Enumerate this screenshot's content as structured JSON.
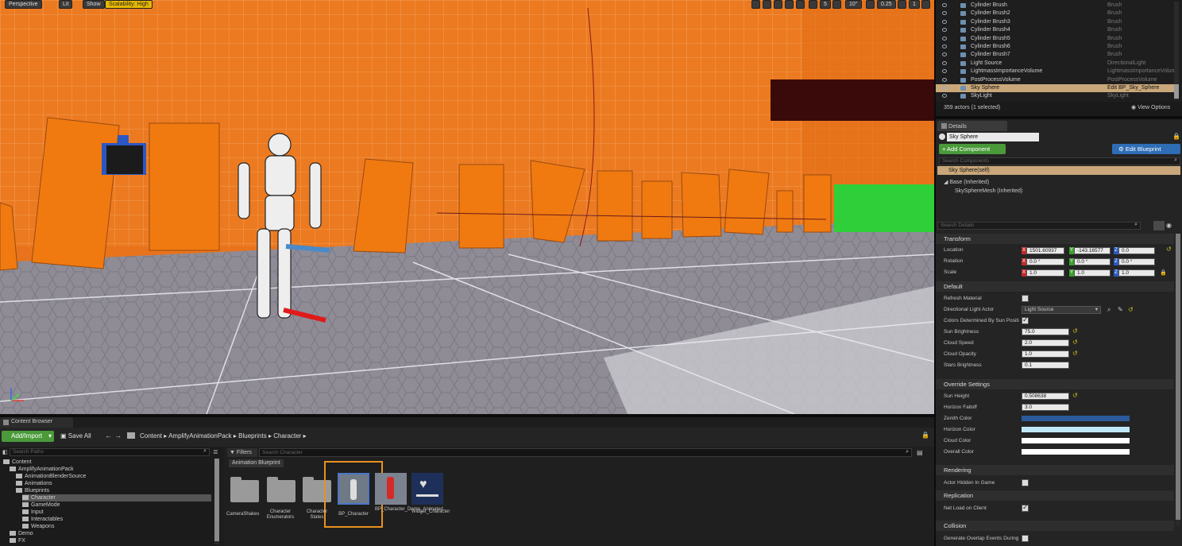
{
  "viewport": {
    "perspective_label": "Perspective",
    "lit_label": "Lit",
    "show_label": "Show",
    "scalability_label": "Scalability: High",
    "grid_snap_value": "5",
    "rotation_snap_value": "10°",
    "scale_snap_value": "0.25",
    "camera_speed_value": "1"
  },
  "outliner": {
    "rows": [
      {
        "name": "Cylinder Brush",
        "type": "Brush"
      },
      {
        "name": "Cylinder Brush2",
        "type": "Brush"
      },
      {
        "name": "Cylinder Brush3",
        "type": "Brush"
      },
      {
        "name": "Cylinder Brush4",
        "type": "Brush"
      },
      {
        "name": "Cylinder Brush5",
        "type": "Brush"
      },
      {
        "name": "Cylinder Brush6",
        "type": "Brush"
      },
      {
        "name": "Cylinder Brush7",
        "type": "Brush"
      },
      {
        "name": "Light Source",
        "type": "DirectionalLight"
      },
      {
        "name": "LightmassImportanceVolume",
        "type": "LightmassImportanceVolume"
      },
      {
        "name": "PostProcessVolume",
        "type": "PostProcessVolume"
      },
      {
        "name": "Sky Sphere",
        "type": "Edit BP_Sky_Sphere"
      },
      {
        "name": "SkyLight",
        "type": "SkyLight"
      }
    ],
    "status": "359 actors (1 selected)",
    "view_options": "View Options"
  },
  "details": {
    "tab_label": "Details",
    "actor_name": "Sky Sphere",
    "add_component": "+ Add Component",
    "edit_blueprint": "Edit Blueprint",
    "search_components_placeholder": "Search Components",
    "components": {
      "self": "Sky Sphere(self)",
      "base": "Base (Inherited)",
      "mesh": "SkySphereMesh (Inherited)"
    },
    "search_details_placeholder": "Search Details",
    "transform": {
      "title": "Transform",
      "location_label": "Location",
      "location": [
        "1501.60937",
        "-143.16577",
        "0.0"
      ],
      "rotation_label": "Rotation",
      "rotation": [
        "0.0 °",
        "0.0 °",
        "0.0 °"
      ],
      "scale_label": "Scale",
      "scale": [
        "1.0",
        "1.0",
        "1.0"
      ],
      "axis_x": "X",
      "axis_y": "Y",
      "axis_z": "Z"
    },
    "default": {
      "title": "Default",
      "refresh_material": "Refresh Material",
      "directional_light_actor": "Directional Light Actor",
      "directional_light_value": "Light Source",
      "colors_determined": "Colors Determined By Sun Positi",
      "sun_brightness_label": "Sun Brightness",
      "sun_brightness": "75.0",
      "cloud_speed_label": "Cloud Speed",
      "cloud_speed": "2.0",
      "cloud_opacity_label": "Cloud Opacity",
      "cloud_opacity": "1.0",
      "stars_brightness_label": "Stars Brightness",
      "stars_brightness": "0.1"
    },
    "override": {
      "title": "Override Settings",
      "sun_height_label": "Sun Height",
      "sun_height": "0.508638",
      "horizon_falloff_label": "Horizon Falloff",
      "horizon_falloff": "3.0",
      "zenith_color": "Zenith Color",
      "horizon_color": "Horizon Color",
      "cloud_color": "Cloud Color",
      "overall_color": "Overall Color",
      "zenith_hex": "#2a5a9a",
      "horizon_hex": "#bfe8fb",
      "cloud_hex": "#ffffff",
      "overall_hex": "#ffffff"
    },
    "rendering": {
      "title": "Rendering",
      "actor_hidden": "Actor Hidden In Game"
    },
    "replication": {
      "title": "Replication",
      "net_load": "Net Load on Client"
    },
    "collision": {
      "title": "Collision",
      "overlap": "Generate Overlap Events During"
    }
  },
  "content_browser": {
    "tab_label": "Content Browser",
    "add_import": "Add/Import",
    "save_all": "Save All",
    "path": [
      "Content",
      "AmplifyAnimationPack",
      "Blueprints",
      "Character"
    ],
    "search_paths_placeholder": "Search Paths",
    "filters_label": "Filters",
    "search_placeholder": "Search Character",
    "filter_chip": "Animation Blueprint",
    "tree": [
      {
        "label": "Content",
        "depth": 0
      },
      {
        "label": "AmplifyAnimationPack",
        "depth": 1
      },
      {
        "label": "AnimationBlenderSource",
        "depth": 2
      },
      {
        "label": "Animations",
        "depth": 2
      },
      {
        "label": "Blueprints",
        "depth": 2
      },
      {
        "label": "Character",
        "depth": 3
      },
      {
        "label": "GameMode",
        "depth": 3
      },
      {
        "label": "Input",
        "depth": 3
      },
      {
        "label": "Interactables",
        "depth": 3
      },
      {
        "label": "Weapons",
        "depth": 3
      },
      {
        "label": "Demo",
        "depth": 1
      },
      {
        "label": "FX",
        "depth": 1
      }
    ],
    "assets": [
      "CameraShakes",
      "Character Enumerators",
      "Character States",
      "BP_Character",
      "BP_Character_Demo_Animated",
      "Widget_Character"
    ]
  },
  "colors": {
    "accent_orange": "#e8731c",
    "highlight_border": "#e89220",
    "add_green": "#4a9a3a",
    "edit_blue": "#2f6db5"
  }
}
